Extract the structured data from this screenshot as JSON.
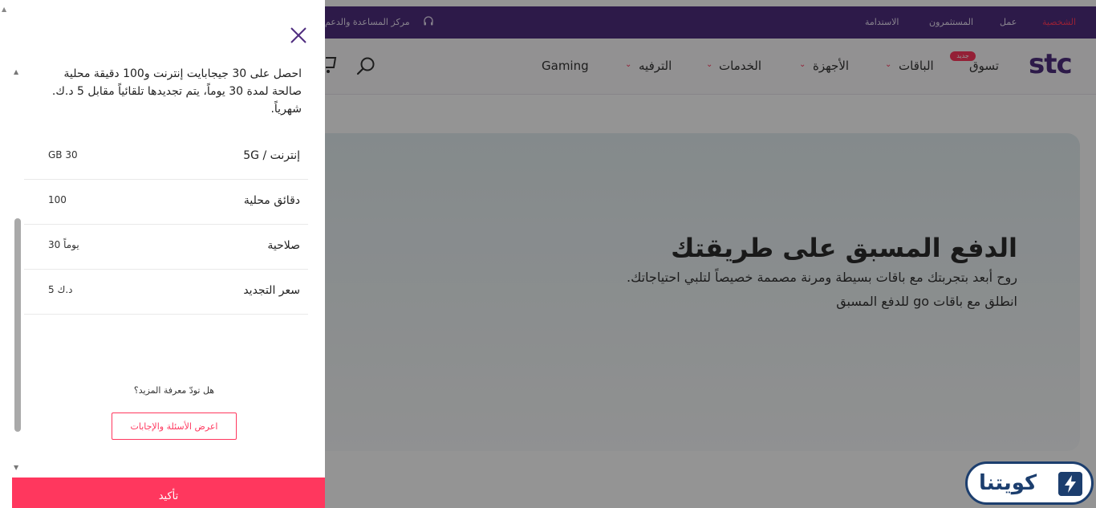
{
  "topbar": {
    "links": [
      "الشخصية",
      "عمل",
      "المستثمرون",
      "الاستدامة"
    ],
    "help": "مركز المساعدة والدعم"
  },
  "nav": {
    "logo": "stc",
    "items": [
      "تسوق",
      "الباقات",
      "الأجهزة",
      "الخدمات",
      "الترفيه",
      "Gaming"
    ],
    "new_badge": "جديد"
  },
  "hero": {
    "title": "الدفع المسبق على طريقتك",
    "subtitle_1": "روح أبعد بتجربتك مع باقات بسيطة ومرنة مصممة خصيصاً لتلبي احتياجاتك.",
    "subtitle_2": "انطلق مع باقات go للدفع المسبق"
  },
  "panel": {
    "description": "احصل على 30 جيجابايت إنترنت و100 دقيقة محلية صالحة لمدة 30 يوماً، يتم تجديدها تلقائياً مقابل 5 د.ك. شهرياً.",
    "rows": [
      {
        "label": "إنترنت / 5G",
        "value": "GB 30"
      },
      {
        "label": "دقائق محلية",
        "value": "100"
      },
      {
        "label": "صلاحية",
        "value": "30 يوماً"
      },
      {
        "label": "سعر التجديد",
        "value": "5 د.ك"
      }
    ],
    "faq_question": "هل تودّ معرفة المزيد؟",
    "faq_button": "اعرض الأسئلة والإجابات",
    "confirm_button": "تأكيد"
  },
  "watermark": {
    "text": "كويتنا"
  },
  "colors": {
    "brand_purple": "#4f2d7f",
    "accent_pink": "#ff375e",
    "watermark_blue": "#1c3e6e"
  }
}
